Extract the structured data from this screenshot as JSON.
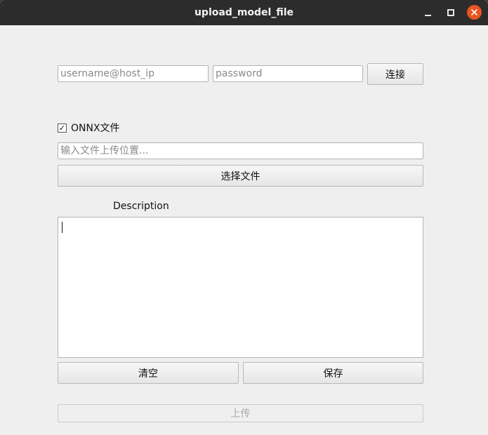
{
  "window": {
    "title": "upload_model_file",
    "close_icon": "close-icon",
    "colors": {
      "titlebar": "#2c2c2c",
      "close": "#e95420",
      "body": "#efefef"
    }
  },
  "connection": {
    "username_placeholder": "username@host_ip",
    "username_value": "",
    "password_placeholder": "password",
    "password_value": "",
    "connect_label": "连接"
  },
  "file": {
    "onnx_checked": true,
    "onnx_check_glyph": "✓",
    "onnx_label": "ONNX文件",
    "path_placeholder": "输入文件上传位置...",
    "path_value": "",
    "choose_label": "选择文件"
  },
  "description": {
    "label": "Description",
    "value": "",
    "clear_label": "清空",
    "save_label": "保存"
  },
  "upload": {
    "label": "上传",
    "enabled": false
  }
}
